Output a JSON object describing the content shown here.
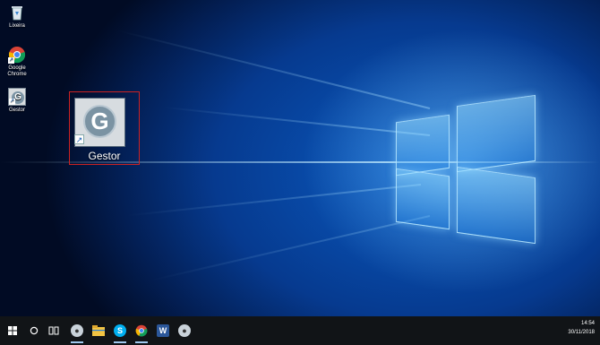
{
  "desktop": {
    "icons": [
      {
        "label": "Lixeira",
        "icon": "recycle-bin-icon"
      },
      {
        "label": "Google Chrome",
        "icon": "chrome-icon"
      },
      {
        "label": "Gestor",
        "icon": "gestor-icon"
      }
    ],
    "selected_icon": {
      "label": "Gestor",
      "icon": "gestor-icon",
      "letter": "G",
      "highlight_color": "#cc2222"
    }
  },
  "taskbar": {
    "items": [
      {
        "icon": "windows-start-icon"
      },
      {
        "icon": "search-icon"
      },
      {
        "icon": "task-view-icon"
      },
      {
        "icon": "app-icon-1"
      },
      {
        "icon": "file-explorer-icon"
      },
      {
        "icon": "skype-icon"
      },
      {
        "icon": "chrome-icon"
      },
      {
        "icon": "word-icon"
      },
      {
        "icon": "app-icon-2"
      }
    ],
    "clock": {
      "time": "14:54",
      "date": "30/11/2018"
    }
  },
  "colors": {
    "taskbar": "#111417",
    "accent": "#1a5fb4"
  }
}
